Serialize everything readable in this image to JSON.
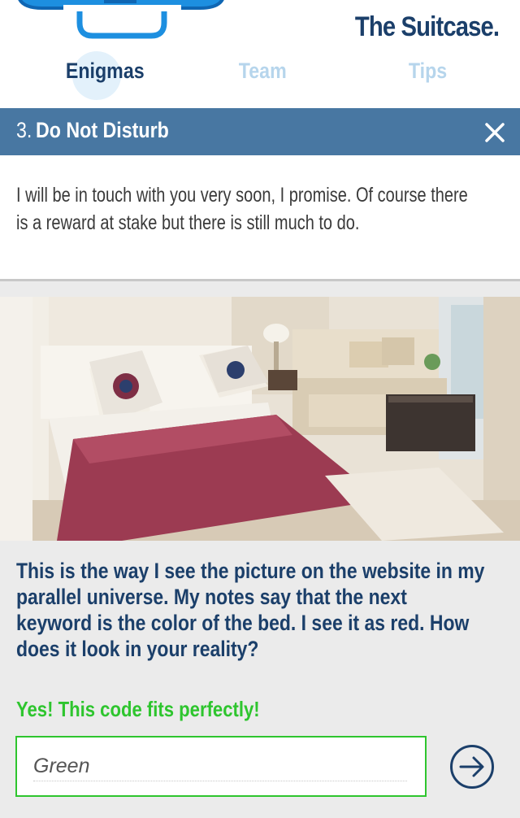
{
  "header": {
    "app_title": "The Suitcase."
  },
  "tabs": [
    {
      "label": "Enigmas",
      "active": true
    },
    {
      "label": "Team",
      "active": false
    },
    {
      "label": "Tips",
      "active": false
    }
  ],
  "enigma": {
    "number": "3.",
    "title": "Do Not Disturb",
    "intro": "I will be in touch with you very soon, I promise. Of course there is a reward at stake but there is still much to do.",
    "question": "This is the way I see the picture on the website in my parallel universe. My notes say that the next keyword is the color of the bed. I see it as red. How does it look in your reality?",
    "success_message": "Yes! This code fits perfectly!",
    "answer_value": "Green"
  },
  "icons": {
    "logo": "suitcase-logo-icon",
    "close": "close-icon",
    "submit": "arrow-right-circle-icon"
  },
  "colors": {
    "primary_dark": "#1b3f6a",
    "title_bar": "#4877a2",
    "inactive_tab": "#b6d5ec",
    "success": "#2ec52e"
  }
}
